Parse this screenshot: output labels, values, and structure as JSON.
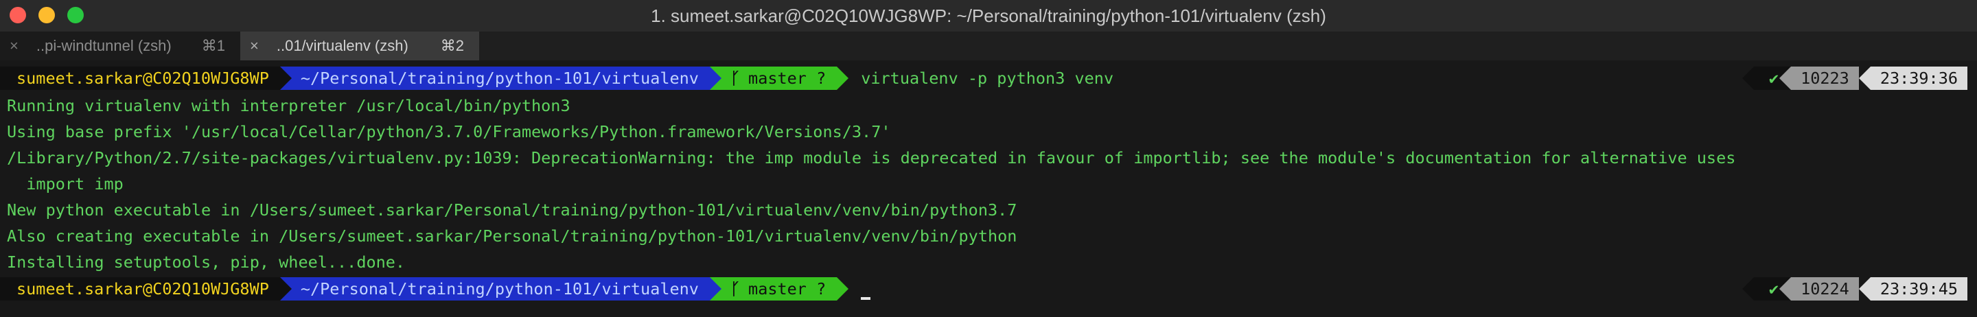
{
  "window": {
    "title": "1. sumeet.sarkar@C02Q10WJG8WP: ~/Personal/training/python-101/virtualenv (zsh)"
  },
  "tabs": [
    {
      "close": "×",
      "label": "..pi-windtunnel (zsh)",
      "shortcut": "⌘1"
    },
    {
      "close": "×",
      "label": "..01/virtualenv (zsh)",
      "shortcut": "⌘2"
    }
  ],
  "prompt1": {
    "user": "sumeet.sarkar@C02Q10WJG8WP",
    "path": "~/Personal/training/python-101/virtualenv",
    "branch_icon": "ᚴ",
    "branch": "master ?",
    "command": "virtualenv -p python3 venv",
    "status": "✔",
    "history": "10223",
    "time": "23:39:36"
  },
  "output": [
    "Running virtualenv with interpreter /usr/local/bin/python3",
    "Using base prefix '/usr/local/Cellar/python/3.7.0/Frameworks/Python.framework/Versions/3.7'",
    "/Library/Python/2.7/site-packages/virtualenv.py:1039: DeprecationWarning: the imp module is deprecated in favour of importlib; see the module's documentation for alternative uses",
    "  import imp",
    "New python executable in /Users/sumeet.sarkar/Personal/training/python-101/virtualenv/venv/bin/python3.7",
    "Also creating executable in /Users/sumeet.sarkar/Personal/training/python-101/virtualenv/venv/bin/python",
    "Installing setuptools, pip, wheel...done."
  ],
  "prompt2": {
    "user": "sumeet.sarkar@C02Q10WJG8WP",
    "path": "~/Personal/training/python-101/virtualenv",
    "branch_icon": "ᚴ",
    "branch": "master ?",
    "status": "✔",
    "history": "10224",
    "time": "23:39:45"
  }
}
